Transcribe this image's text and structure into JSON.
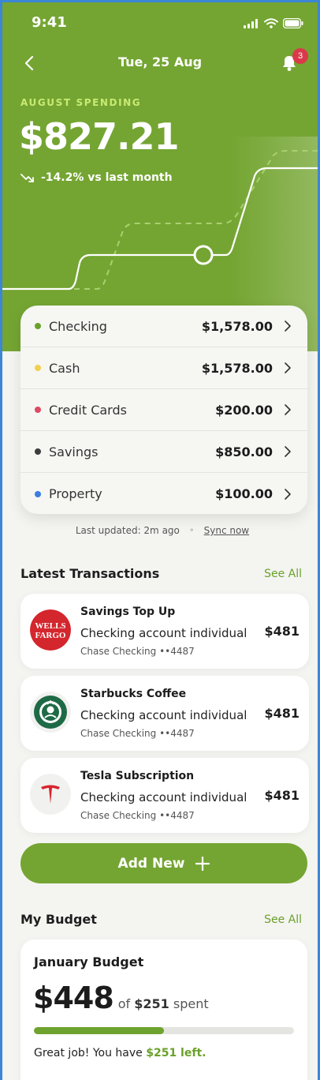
{
  "status": {
    "time": "9:41"
  },
  "nav": {
    "title": "Tue, 25 Aug",
    "badge": "3"
  },
  "summary": {
    "label": "AUGUST SPENDING",
    "amount": "$827.21",
    "change": "-14.2% vs last month"
  },
  "accounts": [
    {
      "name": "Checking",
      "value": "$1,578.00",
      "color": "#6aa12a"
    },
    {
      "name": "Cash",
      "value": "$1,578.00",
      "color": "#f0d04f"
    },
    {
      "name": "Credit Cards",
      "value": "$200.00",
      "color": "#dd4a63"
    },
    {
      "name": "Savings",
      "value": "$850.00",
      "color": "#3d3d3d"
    },
    {
      "name": "Property",
      "value": "$100.00",
      "color": "#3b7de0"
    }
  ],
  "updated": {
    "text": "Last updated: 2m ago",
    "sync": "Sync now"
  },
  "transactions_section": {
    "title": "Latest Transactions",
    "see_all": "See All"
  },
  "transactions": [
    {
      "name": "Savings Top Up",
      "account": "Checking account individual",
      "sub": "Chase Checking ••4487",
      "amount": "$481",
      "logo": "wells-fargo-logo",
      "logo_text_1": "WELLS",
      "logo_text_2": "FARGO"
    },
    {
      "name": "Starbucks Coffee",
      "account": "Checking account individual",
      "sub": "Chase Checking ••4487",
      "amount": "$481",
      "logo": "starbucks-logo"
    },
    {
      "name": "Tesla Subscription",
      "account": "Checking account individual",
      "sub": "Chase Checking ••4487",
      "amount": "$481",
      "logo": "tesla-logo"
    }
  ],
  "add_button": {
    "label": "Add New"
  },
  "budget_section": {
    "title": "My Budget",
    "see_all": "See All"
  },
  "budget": {
    "title": "January Budget",
    "amount": "$448",
    "of_prefix": "of",
    "spent_value": "$251",
    "spent_suffix": "spent",
    "progress": 0.5,
    "message_prefix": "Great job! You have",
    "message_highlight": "$251 left."
  },
  "colors": {
    "accent": "#74a532",
    "badge": "#d93a4a",
    "highlight": "#c9ea72"
  }
}
